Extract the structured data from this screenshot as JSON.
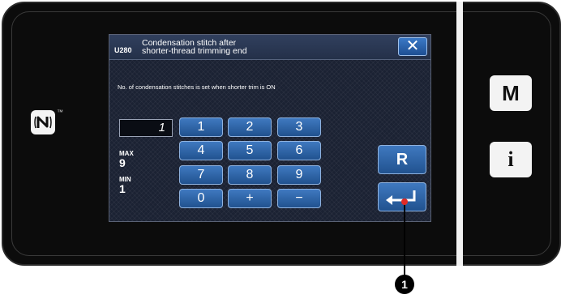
{
  "dialog": {
    "code": "U280",
    "title_line1": "Condensation stitch after",
    "title_line2": "shorter-thread trimming end",
    "close_glyph": "✕",
    "description": "No. of condensation stitches is set when shorter trim is ON"
  },
  "input": {
    "value": "1"
  },
  "limits": {
    "max_label": "MAX",
    "max_value": "9",
    "min_label": "MIN",
    "min_value": "1"
  },
  "keypad": {
    "k1": "1",
    "k2": "2",
    "k3": "3",
    "k4": "4",
    "k5": "5",
    "k6": "6",
    "k7": "7",
    "k8": "8",
    "k9": "9",
    "k0": "0",
    "plus": "+",
    "minus": "−"
  },
  "actions": {
    "reset_label": "R",
    "enter_icon": "enter-arrow-icon"
  },
  "side_buttons": {
    "mode_label": "M",
    "info_label": "i"
  },
  "nfc_icon": "nfc-icon",
  "callout": {
    "label": "1"
  }
}
